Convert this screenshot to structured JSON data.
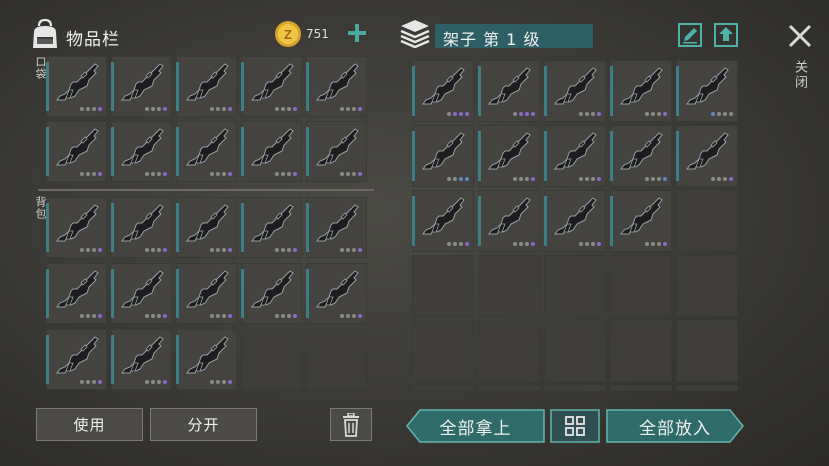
{
  "inventory": {
    "title": "物品栏",
    "coins": "751",
    "pocket_label": "口袋",
    "backpack_label": "背包"
  },
  "shelf": {
    "title": "架子 第 1 级"
  },
  "close_label": "关闭",
  "buttons": {
    "use": "使用",
    "split": "分开",
    "take_all": "全部拿上",
    "put_all": "全部放入"
  },
  "colors": {
    "accent": "#3d7f86",
    "dot_grey": "#8a8a86",
    "dot_purple": "#8b68c9",
    "dot_blue": "#5f86c7"
  },
  "item_icon": "assault-rifle-icon",
  "pocket_slots": [
    {
      "dots": [
        "g",
        "g",
        "g",
        "p"
      ]
    },
    {
      "dots": [
        "g",
        "g",
        "g",
        "p"
      ]
    },
    {
      "dots": [
        "g",
        "g",
        "g",
        "p"
      ]
    },
    {
      "dots": [
        "g",
        "g",
        "g",
        "p"
      ]
    },
    {
      "dots": [
        "g",
        "g",
        "g",
        "p"
      ]
    },
    {
      "dots": [
        "g",
        "g",
        "g",
        "p"
      ]
    },
    {
      "dots": [
        "g",
        "g",
        "g",
        "p"
      ]
    },
    {
      "dots": [
        "g",
        "g",
        "g",
        "p"
      ]
    },
    {
      "dots": [
        "g",
        "g",
        "g",
        "p"
      ]
    },
    {
      "dots": [
        "g",
        "g",
        "g",
        "p"
      ]
    }
  ],
  "backpack_slots": [
    {
      "dots": [
        "g",
        "g",
        "g",
        "p"
      ]
    },
    {
      "dots": [
        "g",
        "g",
        "g",
        "p"
      ]
    },
    {
      "dots": [
        "g",
        "g",
        "g",
        "p"
      ]
    },
    {
      "dots": [
        "g",
        "g",
        "g",
        "p"
      ]
    },
    {
      "dots": [
        "g",
        "g",
        "g",
        "p"
      ]
    },
    {
      "dots": [
        "g",
        "g",
        "g",
        "p"
      ]
    },
    {
      "dots": [
        "g",
        "g",
        "g",
        "p"
      ]
    },
    {
      "dots": [
        "g",
        "g",
        "g",
        "p"
      ]
    },
    {
      "dots": [
        "g",
        "g",
        "g",
        "p"
      ]
    },
    {
      "dots": [
        "g",
        "g",
        "g",
        "p"
      ]
    },
    {
      "dots": [
        "g",
        "g",
        "g",
        "p"
      ]
    },
    {
      "dots": [
        "g",
        "g",
        "g",
        "p"
      ]
    },
    {
      "dots": [
        "g",
        "g",
        "g",
        "p"
      ]
    },
    null,
    null
  ],
  "shelf_slots": [
    {
      "dots": [
        "g",
        "p",
        "p",
        "p"
      ]
    },
    {
      "dots": [
        "g",
        "p",
        "p",
        "p"
      ]
    },
    {
      "dots": [
        "g",
        "g",
        "g",
        "p"
      ]
    },
    {
      "dots": [
        "g",
        "g",
        "g",
        "p"
      ]
    },
    {
      "dots": [
        "b",
        "g",
        "g",
        "g"
      ]
    },
    {
      "dots": [
        "g",
        "g",
        "b",
        "b"
      ]
    },
    {
      "dots": [
        "g",
        "g",
        "g",
        "p"
      ]
    },
    {
      "dots": [
        "g",
        "g",
        "g",
        "p"
      ]
    },
    {
      "dots": [
        "g",
        "g",
        "g",
        "b"
      ]
    },
    {
      "dots": [
        "g",
        "g",
        "g",
        "p"
      ]
    },
    {
      "dots": [
        "g",
        "g",
        "g",
        "p"
      ]
    },
    {
      "dots": [
        "g",
        "g",
        "g",
        "p"
      ]
    },
    {
      "dots": [
        "g",
        "g",
        "g",
        "p"
      ]
    },
    {
      "dots": [
        "g",
        "g",
        "g",
        "p"
      ]
    },
    null,
    null,
    null,
    null,
    null,
    null,
    null,
    null,
    null,
    null,
    null,
    null,
    null,
    null,
    null,
    null
  ]
}
